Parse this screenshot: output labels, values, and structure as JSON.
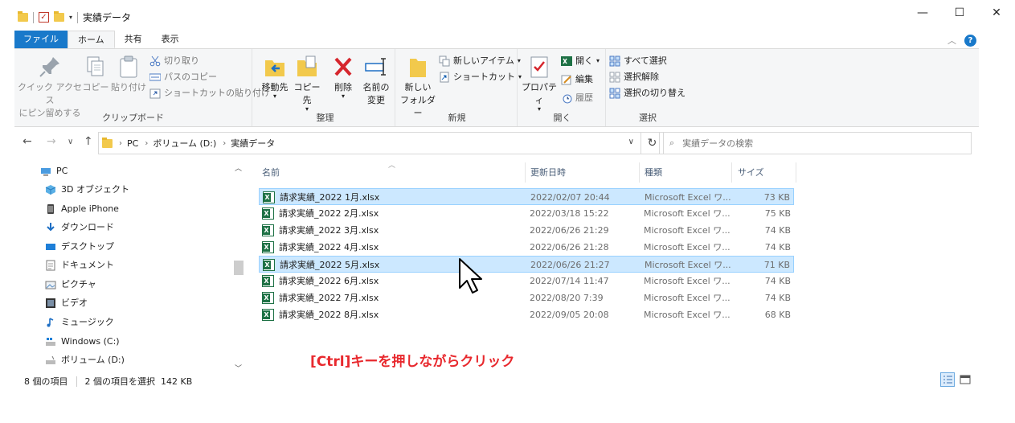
{
  "window": {
    "title": "実績データ",
    "controls": {
      "minimize": "—",
      "maximize": "☐",
      "close": "✕"
    }
  },
  "ribbon_tabs": [
    "ファイル",
    "ホーム",
    "共有",
    "表示"
  ],
  "help_label": "?",
  "ribbon": {
    "clipboard": {
      "label": "クリップボード",
      "pin_line1": "クイック アクセス",
      "pin_line2": "にピン留めする",
      "copy": "コピー",
      "paste": "貼り付け",
      "cut": "切り取り",
      "copy_path": "パスのコピー",
      "paste_shortcut": "ショートカットの貼り付け"
    },
    "organize": {
      "label": "整理",
      "move_to": "移動先",
      "copy_to": "コピー先",
      "delete": "削除",
      "rename_line1": "名前の",
      "rename_line2": "変更"
    },
    "new": {
      "label": "新規",
      "new_folder_line1": "新しい",
      "new_folder_line2": "フォルダー",
      "new_item": "新しいアイテム",
      "shortcut": "ショートカット"
    },
    "open": {
      "label": "開く",
      "properties": "プロパティ",
      "open": "開く",
      "edit": "編集",
      "history": "履歴"
    },
    "select": {
      "label": "選択",
      "select_all": "すべて選択",
      "select_none": "選択解除",
      "invert": "選択の切り替え"
    }
  },
  "address": {
    "crumbs": [
      "PC",
      "ボリューム (D:)",
      "実績データ"
    ],
    "search_placeholder": "実績データの検索"
  },
  "nav_pane": [
    {
      "label": "PC",
      "icon": "pc-icon"
    },
    {
      "label": "3D オブジェクト",
      "icon": "3d-objects-icon"
    },
    {
      "label": "Apple iPhone",
      "icon": "phone-icon"
    },
    {
      "label": "ダウンロード",
      "icon": "download-icon"
    },
    {
      "label": "デスクトップ",
      "icon": "desktop-icon"
    },
    {
      "label": "ドキュメント",
      "icon": "document-icon"
    },
    {
      "label": "ピクチャ",
      "icon": "pictures-icon"
    },
    {
      "label": "ビデオ",
      "icon": "video-icon"
    },
    {
      "label": "ミュージック",
      "icon": "music-icon"
    },
    {
      "label": "Windows (C:)",
      "icon": "drive-c-icon"
    },
    {
      "label": "ボリューム (D:)",
      "icon": "drive-d-icon"
    }
  ],
  "columns": {
    "name": "名前",
    "date": "更新日時",
    "type": "種類",
    "size": "サイズ"
  },
  "files": [
    {
      "name": "請求実績_2022 1月.xlsx",
      "date": "2022/02/07 20:44",
      "type": "Microsoft Excel ワ...",
      "size": "73 KB",
      "selected": true
    },
    {
      "name": "請求実績_2022 2月.xlsx",
      "date": "2022/03/18 15:22",
      "type": "Microsoft Excel ワ...",
      "size": "75 KB",
      "selected": false
    },
    {
      "name": "請求実績_2022 3月.xlsx",
      "date": "2022/06/26 21:29",
      "type": "Microsoft Excel ワ...",
      "size": "74 KB",
      "selected": false
    },
    {
      "name": "請求実績_2022 4月.xlsx",
      "date": "2022/06/26 21:28",
      "type": "Microsoft Excel ワ...",
      "size": "74 KB",
      "selected": false
    },
    {
      "name": "請求実績_2022 5月.xlsx",
      "date": "2022/06/26 21:27",
      "type": "Microsoft Excel ワ...",
      "size": "71 KB",
      "selected": true
    },
    {
      "name": "請求実績_2022 6月.xlsx",
      "date": "2022/07/14 11:47",
      "type": "Microsoft Excel ワ...",
      "size": "74 KB",
      "selected": false
    },
    {
      "name": "請求実績_2022 7月.xlsx",
      "date": "2022/08/20 7:39",
      "type": "Microsoft Excel ワ...",
      "size": "74 KB",
      "selected": false
    },
    {
      "name": "請求実績_2022 8月.xlsx",
      "date": "2022/09/05 20:08",
      "type": "Microsoft Excel ワ...",
      "size": "68 KB",
      "selected": false
    }
  ],
  "caption": "[Ctrl]キーを押しながらクリック",
  "status": {
    "items_count": "8 個の項目",
    "selection": "2 個の項目を選択  142 KB"
  }
}
